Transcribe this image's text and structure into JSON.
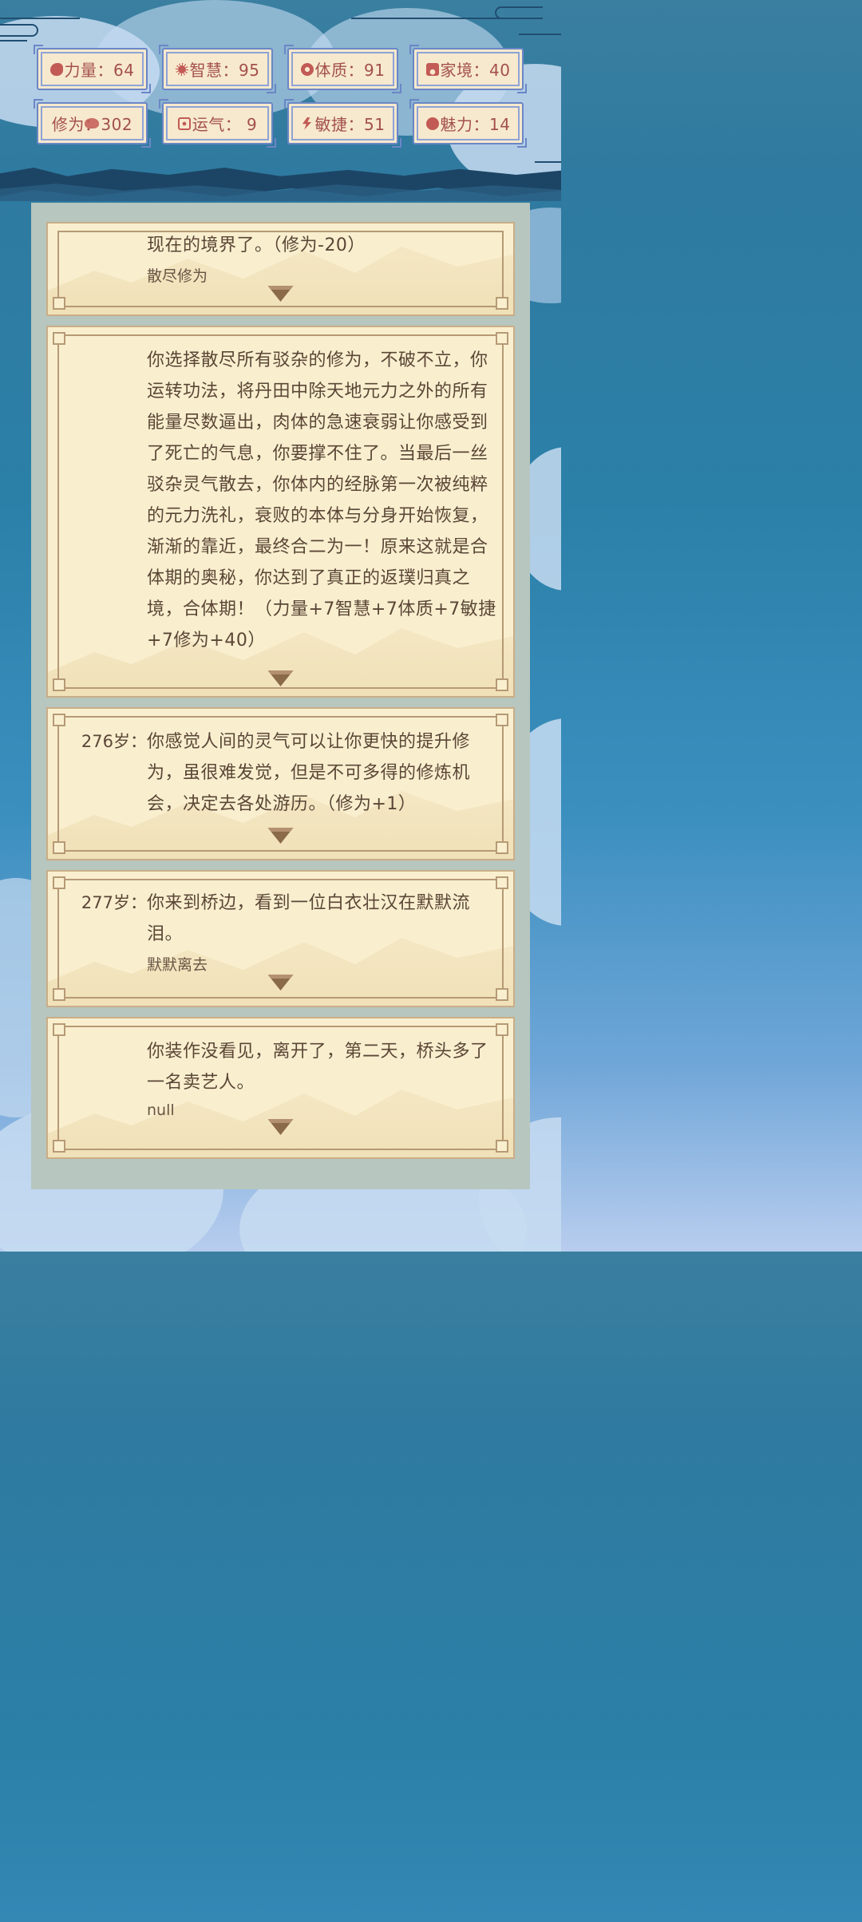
{
  "stats": [
    {
      "icon": "muscle-icon",
      "label": "力量",
      "value": "64",
      "text": "力量：64"
    },
    {
      "icon": "lightbulb-icon",
      "label": "智慧",
      "value": "95",
      "text": "智慧：95"
    },
    {
      "icon": "shield-icon",
      "label": "体质",
      "value": "91",
      "text": "体质：91"
    },
    {
      "icon": "home-icon",
      "label": "家境",
      "value": "40",
      "text": "家境：40"
    },
    {
      "icon": "cloud-icon",
      "label": "修为",
      "value": "302",
      "text": "修为：302"
    },
    {
      "icon": "dice-icon",
      "label": "运气",
      "value": "9",
      "text": "运气： 9"
    },
    {
      "icon": "lightning-icon",
      "label": "敏捷",
      "value": "51",
      "text": "敏捷：51"
    },
    {
      "icon": "heart-icon",
      "label": "魅力",
      "value": "14",
      "text": "魅力：14"
    }
  ],
  "events": [
    {
      "age": "",
      "text": "现在的境界了。（修为-20）",
      "choice": "散尽修为"
    },
    {
      "age": "",
      "text": "你选择散尽所有驳杂的修为，不破不立，你运转功法，将丹田中除天地元力之外的所有能量尽数逼出，肉体的急速衰弱让你感受到了死亡的气息，你要撑不住了。当最后一丝驳杂灵气散去，你体内的经脉第一次被纯粹的元力洗礼，衰败的本体与分身开始恢复，渐渐的靠近，最终合二为一！原来这就是合体期的奥秘，你达到了真正的返璞归真之境，合体期！（力量+7智慧+7体质+7敏捷+7修为+40）",
      "choice": ""
    },
    {
      "age": "276岁：",
      "text": "你感觉人间的灵气可以让你更快的提升修为，虽很难发觉，但是不可多得的修炼机会，决定去各处游历。（修为+1）",
      "choice": ""
    },
    {
      "age": "277岁：",
      "text": "你来到桥边，看到一位白衣壮汉在默默流泪。",
      "choice": "默默离去"
    },
    {
      "age": "",
      "text": "你装作没看见，离开了，第二天，桥头多了一名卖艺人。",
      "choice": "null"
    }
  ],
  "colors": {
    "stat_text": "#a3504c",
    "stat_border": "#6b86c6",
    "card_bg": "#f9efcf",
    "card_text": "#5b4636",
    "panel_bg": "#b7c6be"
  }
}
